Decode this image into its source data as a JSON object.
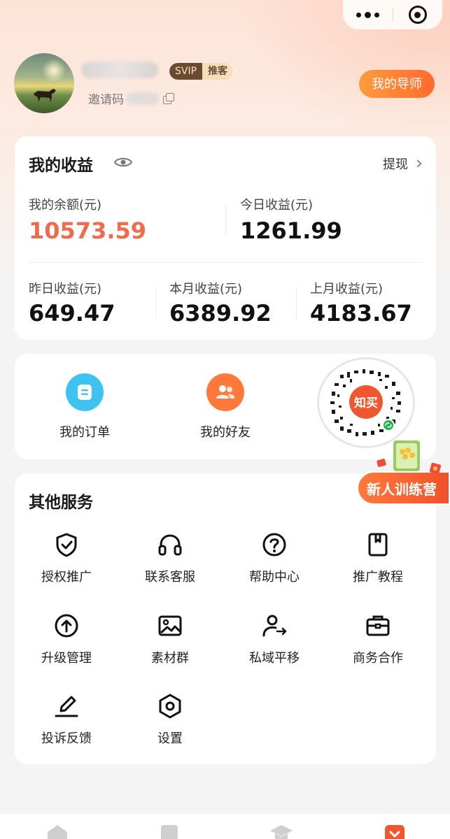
{
  "capsule": {
    "more_icon": "more-dots-icon",
    "close_icon": "target-circle-icon"
  },
  "profile": {
    "badge_svip": "SVIP",
    "badge_recommend": "推客",
    "invite_label": "邀请码",
    "mentor_button": "我的导师"
  },
  "earnings": {
    "title": "我的收益",
    "withdraw": "提现",
    "balance_label": "我的余额(元)",
    "balance_value": "10573.59",
    "today_label": "今日收益(元)",
    "today_value": "1261.99",
    "yesterday_label": "昨日收益(元)",
    "yesterday_value": "649.47",
    "month_label": "本月收益(元)",
    "month_value": "6389.92",
    "last_month_label": "上月收益(元)",
    "last_month_value": "4183.67"
  },
  "quick": {
    "orders": "我的订单",
    "friends": "我的好友",
    "qr_text": "知买"
  },
  "camp": {
    "label": "新人训练营"
  },
  "services": {
    "title": "其他服务",
    "items": [
      {
        "label": "授权推广",
        "icon": "shield-check-icon"
      },
      {
        "label": "联系客服",
        "icon": "headphones-icon"
      },
      {
        "label": "帮助中心",
        "icon": "question-circle-icon"
      },
      {
        "label": "推广教程",
        "icon": "book-icon"
      },
      {
        "label": "升级管理",
        "icon": "arrow-up-circle-icon"
      },
      {
        "label": "素材群",
        "icon": "image-icon"
      },
      {
        "label": "私域平移",
        "icon": "user-transfer-icon"
      },
      {
        "label": "商务合作",
        "icon": "briefcase-icon"
      },
      {
        "label": "投诉反馈",
        "icon": "edit-icon"
      },
      {
        "label": "设置",
        "icon": "settings-hexagon-icon"
      }
    ]
  },
  "colors": {
    "accent": "#f06a4d",
    "orange": "#ff7a3a",
    "blue": "#3ec2f0"
  }
}
